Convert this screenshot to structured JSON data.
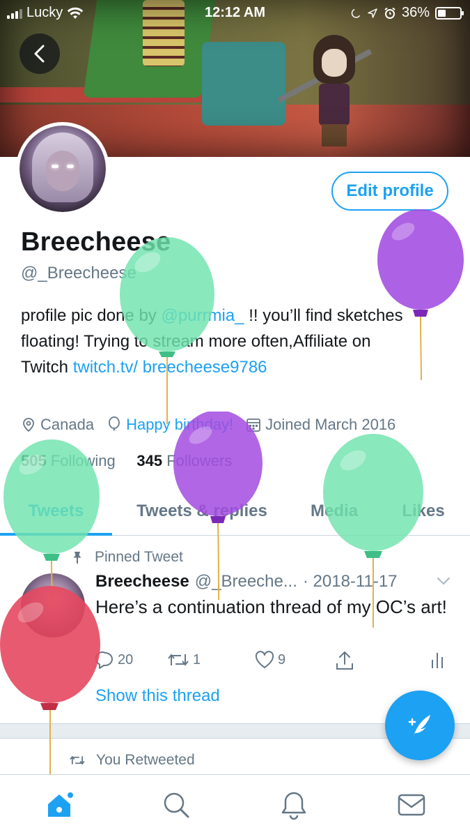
{
  "status_bar": {
    "carrier": "Lucky",
    "time": "12:12 AM",
    "battery": "36%",
    "battery_level": 0.36
  },
  "profile": {
    "display_name": "Breecheese",
    "handle": "@_Breecheese",
    "edit_button": "Edit profile",
    "bio": {
      "part1": "profile pic done by ",
      "mention": "@purrmia_",
      "part2": " !! you’ll find sketches floating! Trying to stream more often,Affiliate on Twitch ",
      "link": "twitch.tv/ breecheese9786"
    },
    "location": "Canada",
    "birthday": "Happy birthday!",
    "joined": "Joined March 2016",
    "following_count": "505",
    "following_label": "Following",
    "followers_count": "345",
    "followers_label": "Followers"
  },
  "tabs": [
    {
      "label": "Tweets",
      "active": true
    },
    {
      "label": "Tweets & replies",
      "active": false
    },
    {
      "label": "Media",
      "active": false
    },
    {
      "label": "Likes",
      "active": false
    }
  ],
  "pinned_tweet": {
    "pinned_label": "Pinned Tweet",
    "author_name": "Breecheese",
    "author_handle": "@_Breeche...",
    "date": "· 2018-11-17",
    "text": "Here’s a continuation thread of my OC’s art!",
    "reply_count": "20",
    "retweet_count": "1",
    "like_count": "9",
    "show_thread": "Show this thread"
  },
  "next_item": {
    "retweeted_label": "You Retweeted"
  },
  "icons": {
    "back": "chevron-left-icon",
    "location": "location-pin-icon",
    "birthday": "balloon-icon",
    "calendar": "calendar-icon",
    "pin": "pin-icon",
    "reply": "reply-icon",
    "retweet": "retweet-icon",
    "like": "heart-icon",
    "share": "share-icon",
    "analytics": "analytics-icon",
    "compose": "compose-icon",
    "home": "home-icon",
    "search": "search-icon",
    "notifications": "bell-icon",
    "messages": "mail-icon"
  },
  "colors": {
    "accent": "#1da1f2",
    "text_primary": "#14171a",
    "text_secondary": "#657786",
    "balloon_green": "#6fe3ad",
    "balloon_purple": "#a24be0",
    "balloon_red": "#e5485f"
  }
}
